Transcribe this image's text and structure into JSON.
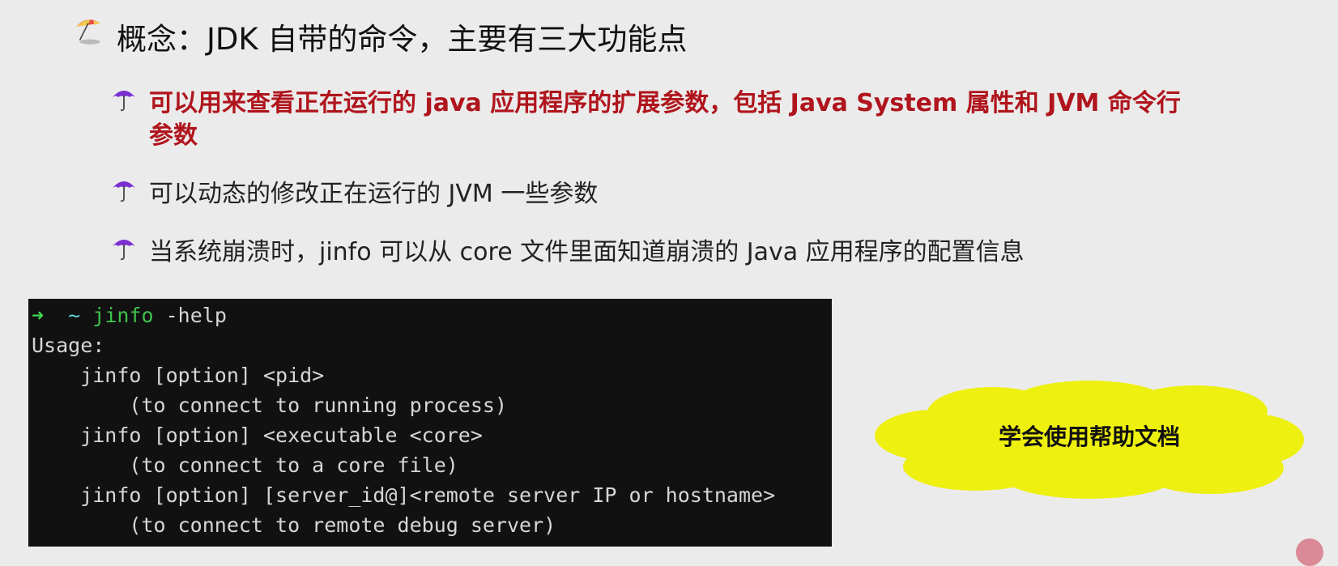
{
  "title": "概念：JDK 自带的命令，主要有三大功能点",
  "bullets": [
    {
      "line1": "可以用来查看正在运行的 java 应用程序的扩展参数，包括 Java System 属性和 JVM 命令行",
      "line2": "参数"
    },
    {
      "line1": "可以动态的修改正在运行的 JVM 一些参数"
    },
    {
      "line1": "当系统崩溃时，jinfo 可以从 core 文件里面知道崩溃的 Java 应用程序的配置信息"
    }
  ],
  "terminal": {
    "prompt_arrow": "➜",
    "prompt_dir": "~",
    "command": "jinfo",
    "args": " -help",
    "lines": [
      "Usage:",
      "    jinfo [option] <pid>",
      "        (to connect to running process)",
      "    jinfo [option] <executable <core>",
      "        (to connect to a core file)",
      "    jinfo [option] [server_id@]<remote server IP or hostname>",
      "        (to connect to remote debug server)"
    ]
  },
  "callout": "学会使用帮助文档",
  "colors": {
    "accent_red": "#b0141c",
    "cloud": "#eef00f",
    "terminal_bg": "#111111"
  }
}
